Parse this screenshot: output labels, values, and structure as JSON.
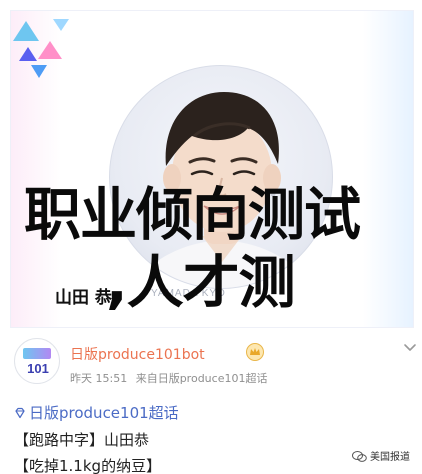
{
  "poster": {
    "name_tag": "山田 恭",
    "romaji": "YAMADA KYO",
    "overlay_title": "职业倾向测试",
    "overlay_subtitle": ",人才测"
  },
  "post": {
    "author": "日版produce101bot",
    "timestamp": "昨天 15:51",
    "source": "来自日版produce101超话",
    "supertopic": "日版produce101超话",
    "line1": "【跑路中字】山田恭",
    "line2": "【吃掉1.1kg的纳豆】",
    "avatar_text": "101"
  },
  "watermark": "美国报道",
  "colors": {
    "author": "#eb7350",
    "link": "#4b6bc5",
    "meta": "#8f8f8f"
  },
  "icons": [
    "crown-icon",
    "chevron-down-icon",
    "diamond-icon",
    "wechat-icon"
  ]
}
